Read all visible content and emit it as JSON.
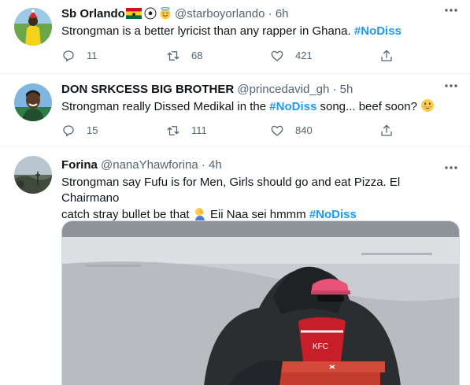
{
  "tweets": [
    {
      "name": "Sb Orlando",
      "handle": "@starboyorlando",
      "separator": "·",
      "time": "6h",
      "text": "Strongman is a better lyricist than any rapper in Ghana.",
      "hashtag": "#NoDiss",
      "replies": "11",
      "retweets": "68",
      "likes": "421"
    },
    {
      "name": "DON SRKCESS BIG BROTHER",
      "handle": "@princedavid_gh",
      "separator": "·",
      "time": "5h",
      "text_before": "Strongman really Dissed Medikal in the",
      "hashtag": "#NoDiss",
      "text_after": "song... beef soon?",
      "replies": "15",
      "retweets": "111",
      "likes": "840"
    },
    {
      "name": "Forina",
      "handle": "@nanaYhawforina",
      "separator": "·",
      "time": "4h",
      "line1": "Strongman say Fufu is for Men,  Girls should go and eat Pizza. El Chairmano",
      "line2_before": "catch stray bullet be that",
      "line2_after": "Eii Naa sei hmmm",
      "hashtag": "#NoDiss"
    }
  ],
  "colors": {
    "hashtag": "#1d9bf0",
    "secondary_text": "#536471",
    "divider": "#eff3f4"
  },
  "icons": [
    "reply-icon",
    "retweet-icon",
    "like-icon",
    "share-icon",
    "more-icon"
  ]
}
